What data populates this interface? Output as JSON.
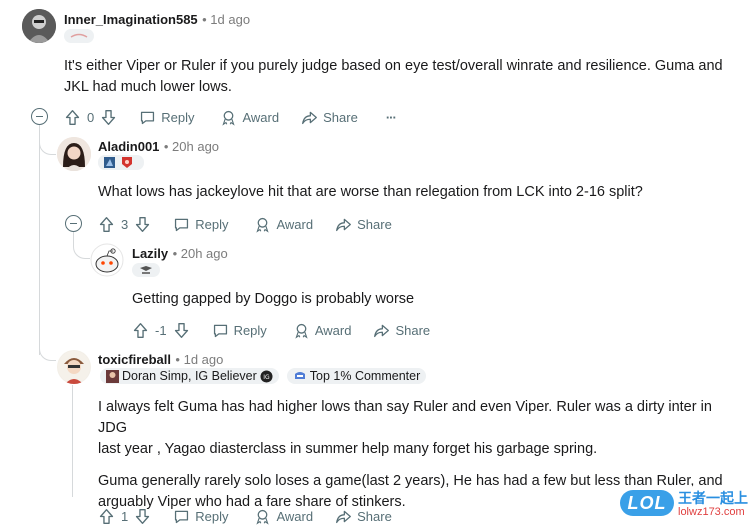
{
  "comments": [
    {
      "username": "Inner_Imagination585",
      "time": "1d ago",
      "text_line1": "It's either Viper or Ruler if you purely judge based on eye test/overall winrate and resilience. Guma and",
      "text_line2": "JKL had much lower lows.",
      "score": "0"
    },
    {
      "username": "Aladin001",
      "time": "20h ago",
      "text_line1": "What lows has jackeylove hit that are worse than relegation from LCK into 2-16 split?",
      "score": "3"
    },
    {
      "username": "Lazily",
      "time": "20h ago",
      "text_line1": "Getting gapped by Doggo is probably worse",
      "score": "-1"
    },
    {
      "username": "toxicfireball",
      "time": "1d ago",
      "flair1": "Doran Simp, IG Believer",
      "flair2": "Top 1% Commenter",
      "text_line1": "I always felt Guma has had higher lows than say Ruler and even Viper. Ruler was a dirty inter in JDG",
      "text_line2": "last year , Yagao diasterclass in summer help many forget his garbage spring.",
      "text_line3": "Guma generally rarely solo loses a game(last 2 years), He has had a few but less than Ruler, and",
      "text_line4": "arguably Viper who had a fare share of stinkers.",
      "score": "1"
    }
  ],
  "actions": {
    "reply": "Reply",
    "award": "Award",
    "share": "Share",
    "more": "···"
  },
  "watermark": {
    "logo": "LOL",
    "brand": "王者一起上",
    "url": "lolwz173.com"
  },
  "colors": {
    "meta": "#7c7c7c",
    "action": "#576f76",
    "thread": "#d6d9db",
    "flair_bg": "#eef1f3"
  }
}
